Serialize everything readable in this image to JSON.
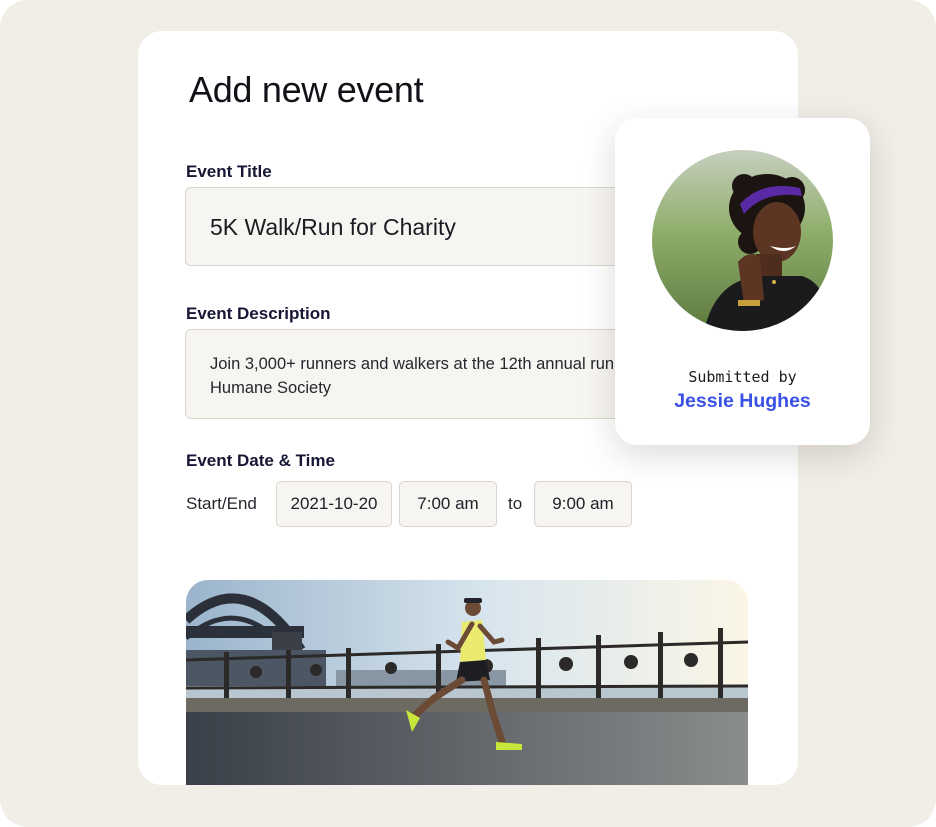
{
  "form": {
    "title": "Add new event",
    "event_title": {
      "label": "Event Title",
      "value": "5K Walk/Run for Charity"
    },
    "event_description": {
      "label": "Event Description",
      "value": "Join 3,000+ runners and walkers at the 12th annual run, benefiting the Humane Society"
    },
    "event_datetime": {
      "label": "Event Date & Time",
      "start_end_label": "Start/End",
      "date": "2021-10-20",
      "start_time": "7:00 am",
      "separator": "to",
      "end_time": "9:00 am"
    }
  },
  "submitter": {
    "caption": "Submitted by",
    "name": "Jessie Hughes"
  },
  "colors": {
    "backdrop": "#f1ede7",
    "input_bg": "#f7f5f1",
    "input_border": "#d9d5cc",
    "label": "#171735",
    "accent": "#3a51e6"
  }
}
